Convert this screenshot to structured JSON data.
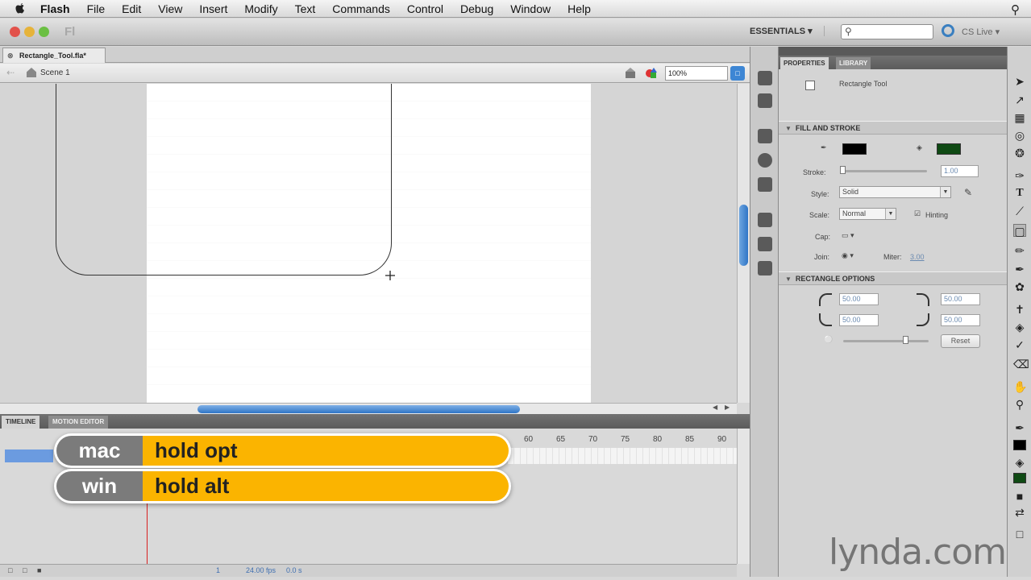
{
  "menubar": {
    "items": [
      "Flash",
      "File",
      "Edit",
      "View",
      "Insert",
      "Modify",
      "Text",
      "Commands",
      "Control",
      "Debug",
      "Window",
      "Help"
    ]
  },
  "appbar": {
    "logo": "Fl",
    "workspace": "ESSENTIALS ▾",
    "search_placeholder": "",
    "cs_live": "CS Live ▾"
  },
  "document": {
    "tab_label": "Rectangle_Tool.fla*",
    "scene": "Scene 1",
    "zoom": "100%"
  },
  "timeline": {
    "tabs": [
      "TIMELINE",
      "MOTION EDITOR"
    ],
    "frame_numbers": [
      "60",
      "65",
      "70",
      "75",
      "80",
      "85",
      "90"
    ],
    "frame": "1",
    "fps": "24.00 fps",
    "seconds": "0.0 s"
  },
  "hotkeys": [
    {
      "os": "mac",
      "key": "hold opt"
    },
    {
      "os": "win",
      "key": "hold alt"
    }
  ],
  "properties": {
    "tabs": [
      "PROPERTIES",
      "LIBRARY"
    ],
    "tool_name": "Rectangle Tool",
    "fill_stroke": {
      "title": "FILL AND STROKE",
      "stroke_color": "#000000",
      "fill_color": "#0f4a14",
      "stroke_label": "Stroke:",
      "stroke_value": "1.00",
      "style_label": "Style:",
      "style_value": "Solid",
      "scale_label": "Scale:",
      "scale_value": "Normal",
      "hinting_label": "Hinting",
      "cap_label": "Cap:",
      "join_label": "Join:",
      "miter_label": "Miter:",
      "miter_value": "3.00"
    },
    "rect_options": {
      "title": "RECTANGLE OPTIONS",
      "radius_tl": "50.00",
      "radius_tr": "50.00",
      "radius_bl": "50.00",
      "radius_br": "50.00",
      "reset_label": "Reset"
    }
  },
  "watermark": "lynda.com"
}
